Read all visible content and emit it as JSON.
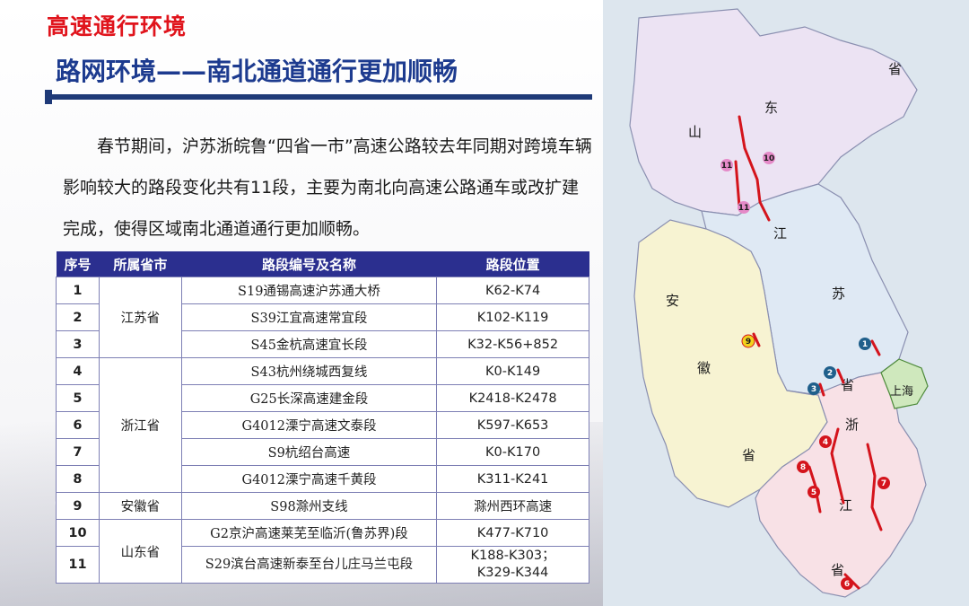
{
  "header": {
    "section_title": "高速通行环境",
    "sub_title": "路网环境——南北通道通行更加顺畅"
  },
  "intro_text": "春节期间，沪苏浙皖鲁“四省一市”高速公路较去年同期对跨境车辆影响较大的路段变化共有11段，主要为南北向高速公路通车或改扩建完成，使得区域南北通道通行更加顺畅。",
  "table": {
    "headers": [
      "序号",
      "所属省市",
      "路段编号及名称",
      "路段位置"
    ],
    "groups": {
      "jiangsu": "江苏省",
      "zhejiang": "浙江省",
      "anhui": "安徽省",
      "shandong": "山东省"
    },
    "rows": [
      {
        "no": "1",
        "name": "S19通锡高速沪苏通大桥",
        "pos": "K62-K74"
      },
      {
        "no": "2",
        "name": "S39江宜高速常宜段",
        "pos": "K102-K119"
      },
      {
        "no": "3",
        "name": "S45金杭高速宜长段",
        "pos": "K32-K56+852"
      },
      {
        "no": "4",
        "name": "S43杭州绕城西复线",
        "pos": "K0-K149"
      },
      {
        "no": "5",
        "name": "G25长深高速建金段",
        "pos": "K2418-K2478"
      },
      {
        "no": "6",
        "name": "G4012溧宁高速文泰段",
        "pos": "K597-K653"
      },
      {
        "no": "7",
        "name": "S9杭绍台高速",
        "pos": "K0-K170"
      },
      {
        "no": "8",
        "name": "G4012溧宁高速千黄段",
        "pos": "K311-K241"
      },
      {
        "no": "9",
        "name": "S98滁州支线",
        "pos": "滁州西环高速"
      },
      {
        "no": "10",
        "name": "G2京沪高速莱芜至临沂(鲁苏界)段",
        "pos": "K477-K710"
      },
      {
        "no": "11",
        "name": "S29滨台高速新泰至台儿庄马兰屯段",
        "pos_line1": "K188-K303；",
        "pos_line2": "K329-K344"
      }
    ]
  },
  "map": {
    "labels": {
      "shandong_1": "山",
      "shandong_2": "东",
      "shandong_3": "省",
      "jiangsu_1": "江",
      "jiangsu_2": "苏",
      "jiangsu_3": "省",
      "anhui_1": "安",
      "anhui_2": "徽",
      "anhui_3": "省",
      "zhejiang_1": "浙",
      "zhejiang_2": "江",
      "zhejiang_3": "省",
      "shanghai": "上海"
    },
    "markers": [
      "1",
      "2",
      "3",
      "4",
      "5",
      "6",
      "7",
      "8",
      "9",
      "10",
      "11",
      "11"
    ],
    "colors": {
      "shandong": "#ece3f3",
      "jiangsu": "#dfe9f4",
      "anhui": "#f7f3d2",
      "zhejiang": "#f8e1e6",
      "shanghai": "#cfe8bd",
      "sea": "#dde6ee",
      "route": "#d4141c"
    }
  }
}
